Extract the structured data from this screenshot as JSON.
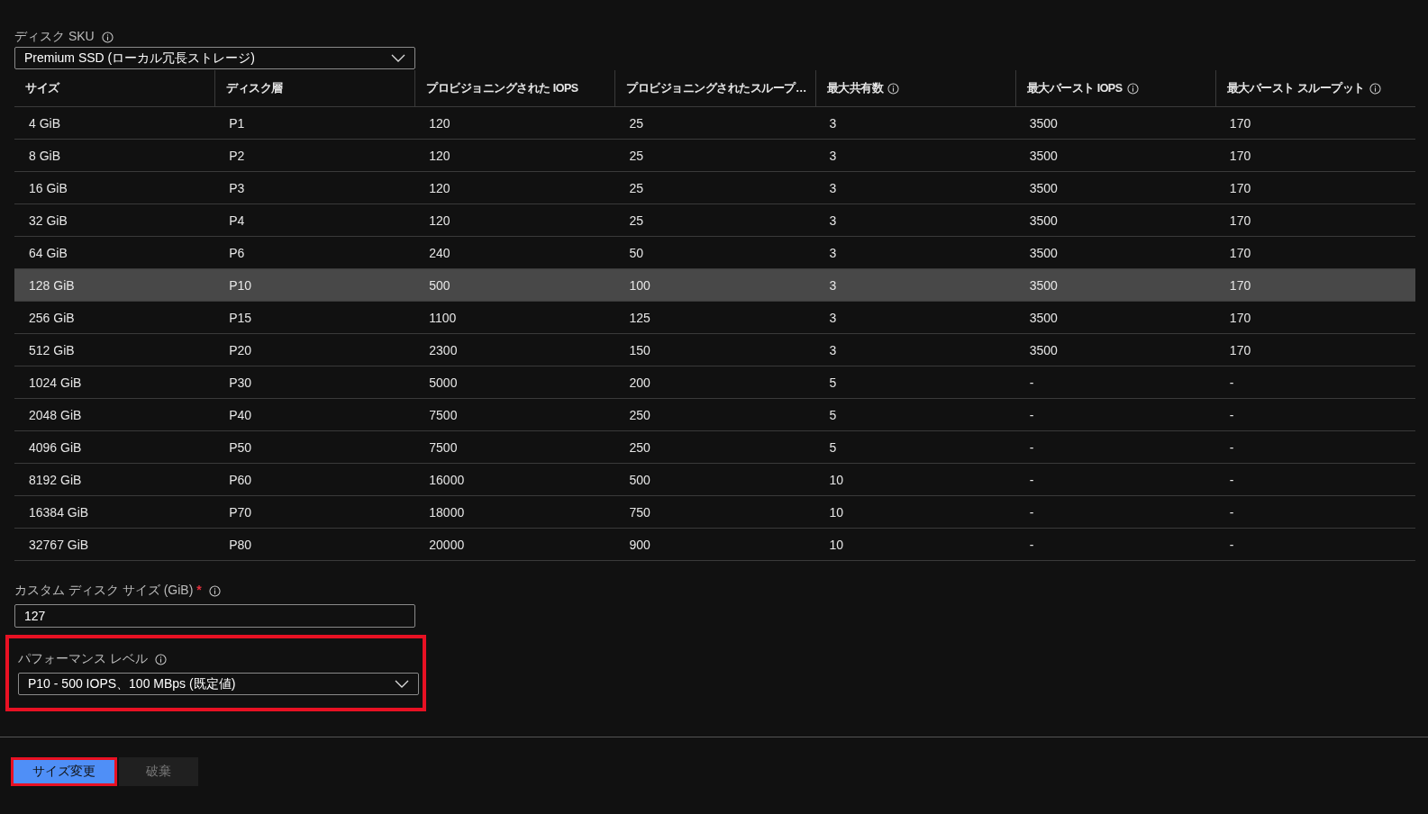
{
  "sku": {
    "label": "ディスク SKU",
    "value": "Premium SSD (ローカル冗長ストレージ)"
  },
  "table": {
    "columns": [
      {
        "label": "サイズ",
        "info": false
      },
      {
        "label": "ディスク層",
        "info": false
      },
      {
        "label": "プロビジョニングされた IOPS",
        "info": false
      },
      {
        "label": "プロビジョニングされたスループ…",
        "info": false
      },
      {
        "label": "最大共有数",
        "info": true
      },
      {
        "label": "最大バースト IOPS",
        "info": true
      },
      {
        "label": "最大バースト スループット",
        "info": true
      }
    ],
    "rows": [
      {
        "cells": [
          "4 GiB",
          "P1",
          "120",
          "25",
          "3",
          "3500",
          "170"
        ],
        "selected": false
      },
      {
        "cells": [
          "8 GiB",
          "P2",
          "120",
          "25",
          "3",
          "3500",
          "170"
        ],
        "selected": false
      },
      {
        "cells": [
          "16 GiB",
          "P3",
          "120",
          "25",
          "3",
          "3500",
          "170"
        ],
        "selected": false
      },
      {
        "cells": [
          "32 GiB",
          "P4",
          "120",
          "25",
          "3",
          "3500",
          "170"
        ],
        "selected": false
      },
      {
        "cells": [
          "64 GiB",
          "P6",
          "240",
          "50",
          "3",
          "3500",
          "170"
        ],
        "selected": false
      },
      {
        "cells": [
          "128 GiB",
          "P10",
          "500",
          "100",
          "3",
          "3500",
          "170"
        ],
        "selected": true
      },
      {
        "cells": [
          "256 GiB",
          "P15",
          "1100",
          "125",
          "3",
          "3500",
          "170"
        ],
        "selected": false
      },
      {
        "cells": [
          "512 GiB",
          "P20",
          "2300",
          "150",
          "3",
          "3500",
          "170"
        ],
        "selected": false
      },
      {
        "cells": [
          "1024 GiB",
          "P30",
          "5000",
          "200",
          "5",
          "-",
          "-"
        ],
        "selected": false
      },
      {
        "cells": [
          "2048 GiB",
          "P40",
          "7500",
          "250",
          "5",
          "-",
          "-"
        ],
        "selected": false
      },
      {
        "cells": [
          "4096 GiB",
          "P50",
          "7500",
          "250",
          "5",
          "-",
          "-"
        ],
        "selected": false
      },
      {
        "cells": [
          "8192 GiB",
          "P60",
          "16000",
          "500",
          "10",
          "-",
          "-"
        ],
        "selected": false
      },
      {
        "cells": [
          "16384 GiB",
          "P70",
          "18000",
          "750",
          "10",
          "-",
          "-"
        ],
        "selected": false
      },
      {
        "cells": [
          "32767 GiB",
          "P80",
          "20000",
          "900",
          "10",
          "-",
          "-"
        ],
        "selected": false
      }
    ]
  },
  "custom_size": {
    "label": "カスタム ディスク サイズ (GiB)",
    "required_mark": "*",
    "value": "127"
  },
  "performance": {
    "label": "パフォーマンス レベル",
    "value": "P10 - 500 IOPS、100 MBps (既定値)",
    "highlighted": true
  },
  "buttons": [
    {
      "label": "サイズ変更",
      "kind": "primary",
      "disabled": false,
      "highlighted": true
    },
    {
      "label": "破棄",
      "kind": "secondary",
      "disabled": true,
      "highlighted": false
    }
  ]
}
